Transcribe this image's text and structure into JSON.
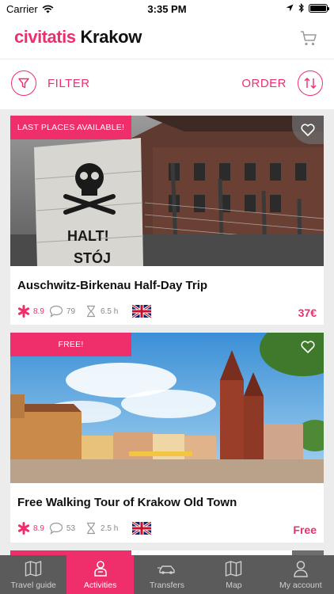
{
  "status_bar": {
    "carrier": "Carrier",
    "time": "3:35 PM"
  },
  "header": {
    "logo": "civitatis",
    "city": "Krakow"
  },
  "toolbar": {
    "filter_label": "FILTER",
    "order_label": "ORDER"
  },
  "accent_color": "#ee2f6b",
  "activities": [
    {
      "ribbon": "LAST PLACES AVAILABLE!",
      "title": "Auschwitz-Birkenau Half-Day Trip",
      "rating": "8.9",
      "reviews": "79",
      "duration": "6.5 h",
      "language_flag": "uk-flag",
      "price": "37€"
    },
    {
      "ribbon": "FREE!",
      "title": "Free Walking Tour of Krakow Old Town",
      "rating": "8.9",
      "reviews": "53",
      "duration": "2.5 h",
      "language_flag": "uk-flag",
      "price": "Free"
    }
  ],
  "tabbar": {
    "items": [
      {
        "label": "Travel guide",
        "icon": "map-book-icon"
      },
      {
        "label": "Activities",
        "icon": "person-icon",
        "active": true
      },
      {
        "label": "Transfers",
        "icon": "car-icon"
      },
      {
        "label": "Map",
        "icon": "map-icon"
      },
      {
        "label": "My account",
        "icon": "user-icon"
      }
    ]
  }
}
